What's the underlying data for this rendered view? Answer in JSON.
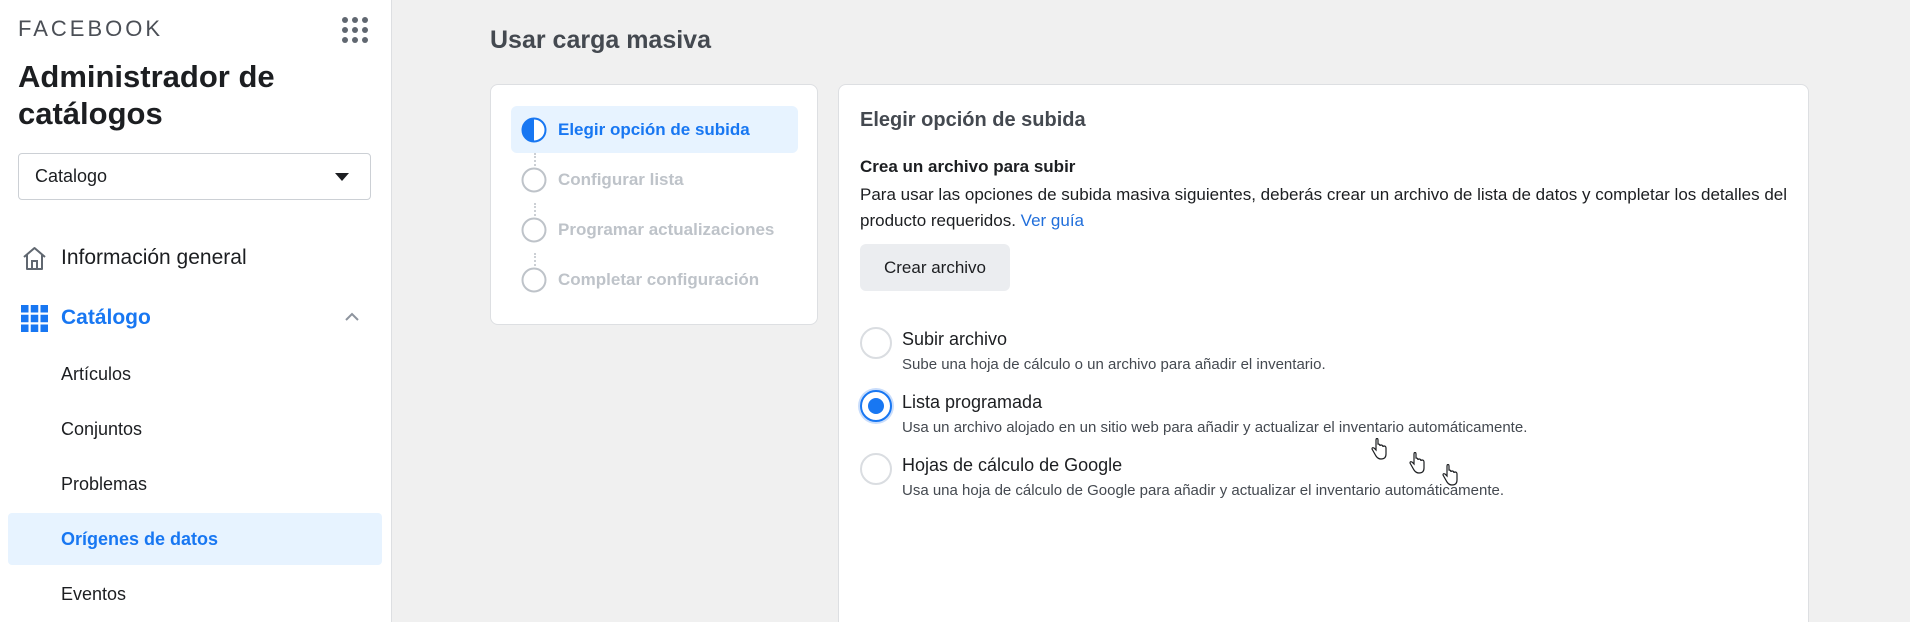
{
  "sidebar": {
    "brand": "FACEBOOK",
    "app_title": "Administrador de catálogos",
    "catalog_select": {
      "value": "Catalogo"
    },
    "nav": {
      "overview": {
        "label": "Información general",
        "icon": "home-icon"
      },
      "catalog": {
        "label": "Catálogo",
        "icon": "grid-icon",
        "expanded": true
      },
      "sub_items": [
        {
          "label": "Artículos",
          "active": false
        },
        {
          "label": "Conjuntos",
          "active": false
        },
        {
          "label": "Problemas",
          "active": false
        },
        {
          "label": "Orígenes de datos",
          "active": true
        },
        {
          "label": "Eventos",
          "active": false
        }
      ]
    }
  },
  "main": {
    "page_title": "Usar carga masiva",
    "steps": [
      {
        "label": "Elegir opción de subida",
        "active": true
      },
      {
        "label": "Configurar lista",
        "active": false
      },
      {
        "label": "Programar actualizaciones",
        "active": false
      },
      {
        "label": "Completar configuración",
        "active": false
      }
    ],
    "card": {
      "title": "Elegir opción de subida",
      "section_heading": "Crea un archivo para subir",
      "section_desc": "Para usar las opciones de subida masiva siguientes, deberás crear un archivo de lista de datos y completar los detalles del producto requeridos.",
      "guide_link": "Ver guía",
      "create_button": "Crear archivo",
      "options": [
        {
          "label": "Subir archivo",
          "desc": "Sube una hoja de cálculo o un archivo para añadir el inventario.",
          "selected": false
        },
        {
          "label": "Lista programada",
          "desc": "Usa un archivo alojado en un sitio web para añadir y actualizar el inventario automáticamente.",
          "selected": true
        },
        {
          "label": "Hojas de cálculo de Google",
          "desc": "Usa una hoja de cálculo de Google para añadir y actualizar el inventario automáticamente.",
          "selected": false
        }
      ]
    }
  },
  "colors": {
    "accent": "#1877f2",
    "active_bg": "#e7f3ff",
    "page_bg": "#f0f0f0"
  }
}
